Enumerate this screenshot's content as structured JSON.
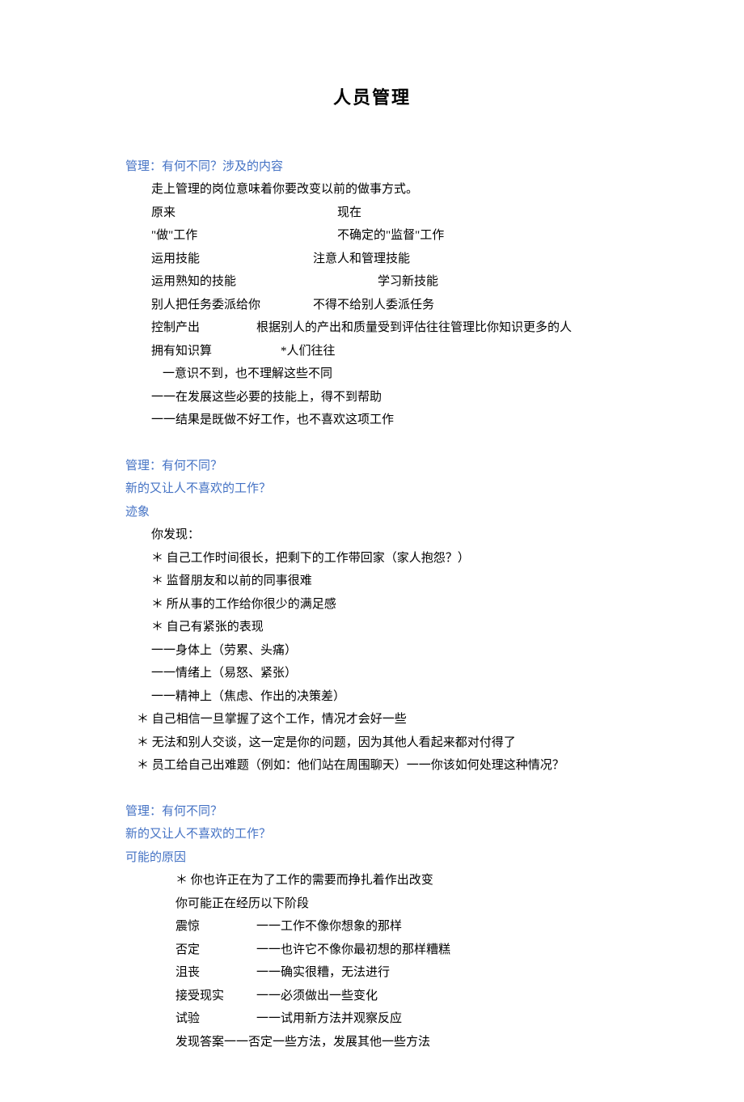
{
  "title": "人员管理",
  "section1": {
    "heading": "管理：有何不同？涉及的内容",
    "intro": "走上管理的岗位意味着你要改变以前的做事方式。",
    "table": {
      "h1": "原来",
      "h2": "现在",
      "r1a": "\"做\"工作",
      "r1b": "不确定的\"监督\"工作",
      "r2a": "运用技能",
      "r2b": "注意人和管理技能",
      "r3a": "运用熟知的技能",
      "r3b": "学习新技能",
      "r4a": "别人把任务委派给你",
      "r4b": "不得不给别人委派任务",
      "r5a": "控制产出",
      "r5b": "根据别人的产出和质量受到评估往往管理比你知识更多的人",
      "r6a": "拥有知识算",
      "r6b": "*人们往往"
    },
    "bullets": {
      "b1": "一意识不到，也不理解这些不同",
      "b2": "一一在发展这些必要的技能上，得不到帮助",
      "b3": "一一结果是既做不好工作，也不喜欢这项工作"
    }
  },
  "section2": {
    "h1": "管理：有何不同？",
    "h2": "新的又让人不喜欢的工作？",
    "h3": "迹象",
    "intro": "你发现：",
    "items": {
      "i1": "＊  自己工作时间很长，把剩下的工作带回家（家人抱怨？）",
      "i2": "＊  监督朋友和以前的同事很难",
      "i3": "＊  所从事的工作给你很少的满足感",
      "i4": "＊  自己有紧张的表现",
      "s1": "一一身体上（劳累、头痛）",
      "s2": "一一情绪上（易怒、紧张）",
      "s3": "一一精神上（焦虑、作出的决策差）",
      "i5": "＊  自己相信一旦掌握了这个工作，情况才会好一些",
      "i6": "＊  无法和别人交谈，这一定是你的问题，因为其他人看起来都对付得了",
      "i7": "＊  员工给自己出难题（例如：他们站在周围聊天）一一你该如何处理这种情况？"
    }
  },
  "section3": {
    "h1": "管理：有何不同？",
    "h2": "新的又让人不喜欢的工作？",
    "h3": "可能的原因",
    "intro1": "＊  你也许正在为了工作的需要而挣扎着作出改变",
    "intro2": "你可能正在经历以下阶段",
    "rows": {
      "r1a": "震惊",
      "r1b": "一一工作不像你想象的那样",
      "r2a": "否定",
      "r2b": "一一也许它不像你最初想的那样糟糕",
      "r3a": "沮丧",
      "r3b": "一一确实很糟，无法进行",
      "r4a": "接受现实",
      "r4b": "一一必须做出一些变化",
      "r5a": "试验",
      "r5b": "一一试用新方法并观察反应",
      "r6": "发现答案一一否定一些方法，发展其他一些方法"
    }
  }
}
